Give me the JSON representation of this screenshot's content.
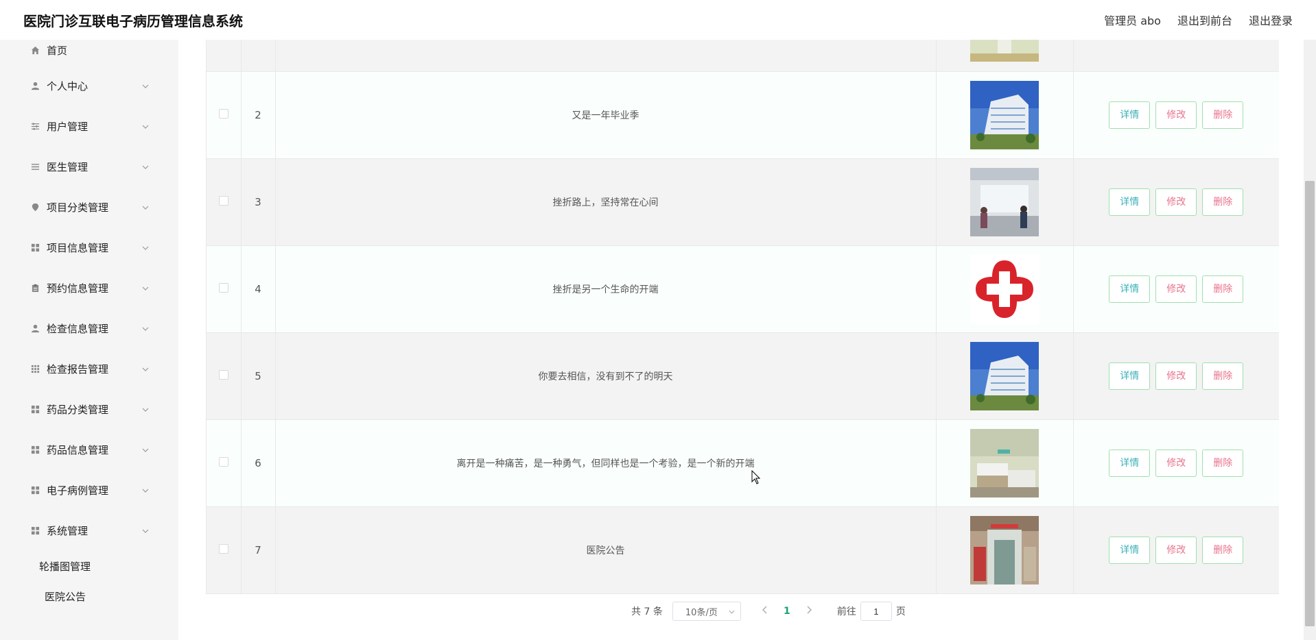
{
  "header": {
    "title": "医院门诊互联电子病历管理信息系统",
    "admin": "管理员 abo",
    "to_front": "退出到前台",
    "logout": "退出登录"
  },
  "sidebar": {
    "home": "首页",
    "items": [
      {
        "label": "个人中心",
        "icon": "person-icon"
      },
      {
        "label": "用户管理",
        "icon": "sliders-icon"
      },
      {
        "label": "医生管理",
        "icon": "list-icon"
      },
      {
        "label": "项目分类管理",
        "icon": "pin-icon"
      },
      {
        "label": "项目信息管理",
        "icon": "grid-icon"
      },
      {
        "label": "预约信息管理",
        "icon": "clipboard-icon"
      },
      {
        "label": "检查信息管理",
        "icon": "person-icon"
      },
      {
        "label": "检查报告管理",
        "icon": "apps-icon"
      },
      {
        "label": "药品分类管理",
        "icon": "grid-icon"
      },
      {
        "label": "药品信息管理",
        "icon": "grid-icon"
      },
      {
        "label": "电子病例管理",
        "icon": "grid-icon"
      },
      {
        "label": "系统管理",
        "icon": "grid-icon"
      }
    ],
    "sub_items": [
      "轮播图管理",
      "医院公告"
    ]
  },
  "table": {
    "rows": [
      {
        "index": "",
        "title": "",
        "image": "hospital-corridor"
      },
      {
        "index": "2",
        "title": "又是一年毕业季",
        "image": "hospital-building"
      },
      {
        "index": "3",
        "title": "挫折路上，坚持常在心间",
        "image": "hospital-lobby"
      },
      {
        "index": "4",
        "title": "挫折是另一个生命的开端",
        "image": "red-cross-logo"
      },
      {
        "index": "5",
        "title": "你要去相信，没有到不了的明天",
        "image": "hospital-building"
      },
      {
        "index": "6",
        "title": "离开是一种痛苦，是一种勇气，但同样也是一个考验，是一个新的开端",
        "image": "hospital-ward"
      },
      {
        "index": "7",
        "title": "医院公告",
        "image": "hospital-entrance"
      }
    ],
    "actions": {
      "detail": "详情",
      "edit": "修改",
      "delete": "删除"
    }
  },
  "pager": {
    "total": "共 7 条",
    "page_size": "10条/页",
    "current": "1",
    "goto_prefix": "前往",
    "goto_value": "1",
    "goto_suffix": "页"
  },
  "colors": {
    "accent": "#19a27a",
    "btn_border": "#9fdfad",
    "detail_text": "#3bb0b8",
    "danger_text": "#e8748c"
  }
}
